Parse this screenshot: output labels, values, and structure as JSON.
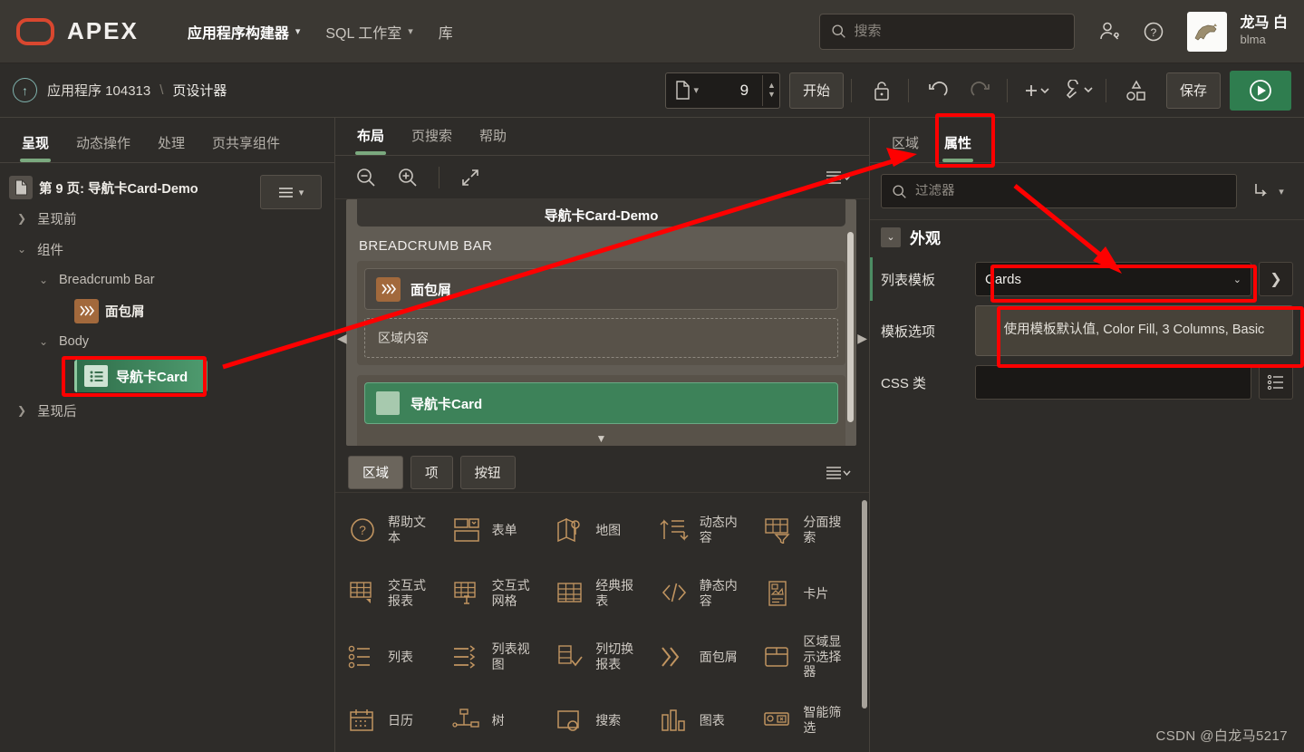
{
  "topnav": {
    "brand": "APEX",
    "items": [
      {
        "label": "应用程序构建器",
        "caret": true,
        "active": true
      },
      {
        "label": "SQL 工作室",
        "caret": true,
        "active": false
      },
      {
        "label": "库",
        "caret": false,
        "active": false
      }
    ],
    "search_placeholder": "搜索",
    "user_name": "龙马 白",
    "user_handle": "blma",
    "icons": [
      "user-settings-icon",
      "help-icon"
    ]
  },
  "toolbar": {
    "breadcrumb": {
      "app": "应用程序 104313",
      "sep": "\\",
      "current": "页设计器"
    },
    "page_number": "9",
    "start_label": "开始",
    "save_label": "保存",
    "icons": [
      "lock-icon",
      "undo-icon",
      "redo-icon",
      "add-icon",
      "utilities-icon",
      "shapes-icon",
      "run-icon"
    ]
  },
  "left_panel": {
    "tabs": [
      {
        "label": "呈现",
        "active": true
      },
      {
        "label": "动态操作",
        "active": false
      },
      {
        "label": "处理",
        "active": false
      },
      {
        "label": "页共享组件",
        "active": false
      }
    ],
    "tree": [
      {
        "label": "第 9 页: 导航卡Card-Demo",
        "type": "page",
        "indent": 0,
        "twisty": "",
        "bold": true
      },
      {
        "label": "呈现前",
        "type": "folder",
        "indent": 1,
        "twisty": "collapsed"
      },
      {
        "label": "组件",
        "type": "folder",
        "indent": 1,
        "twisty": "expanded"
      },
      {
        "label": "Breadcrumb Bar",
        "type": "folder",
        "indent": 2,
        "twisty": "expanded"
      },
      {
        "label": "面包屑",
        "type": "breadcrumb",
        "indent": 3,
        "twisty": ""
      },
      {
        "label": "Body",
        "type": "folder",
        "indent": 2,
        "twisty": "expanded"
      },
      {
        "label": "导航卡Card",
        "type": "list-selected",
        "indent": 3,
        "twisty": ""
      },
      {
        "label": "呈现后",
        "type": "folder",
        "indent": 1,
        "twisty": "collapsed"
      }
    ]
  },
  "center_panel": {
    "tabs": [
      {
        "label": "布局",
        "active": true
      },
      {
        "label": "页搜索",
        "active": false
      },
      {
        "label": "帮助",
        "active": false
      }
    ],
    "layout_toolbar_icons": [
      "zoom-out-icon",
      "zoom-in-icon",
      "expand-icon",
      "menu-icon"
    ],
    "preview": {
      "page_title": "导航卡Card-Demo",
      "section_title": "BREADCRUMB BAR",
      "breadcrumb_region": "面包屑",
      "region_content_placeholder": "区域内容",
      "card_region": "导航卡Card"
    },
    "gallery": {
      "tabs": [
        {
          "label": "区域",
          "active": true
        },
        {
          "label": "项",
          "active": false
        },
        {
          "label": "按钮",
          "active": false
        }
      ],
      "items": [
        {
          "label": "帮助文本",
          "icon": "help-text-icon"
        },
        {
          "label": "表单",
          "icon": "form-icon"
        },
        {
          "label": "地图",
          "icon": "map-icon"
        },
        {
          "label": "动态内容",
          "icon": "dynamic-content-icon"
        },
        {
          "label": "分面搜索",
          "icon": "faceted-search-icon"
        },
        {
          "label": "交互式报表",
          "icon": "interactive-report-icon"
        },
        {
          "label": "交互式网格",
          "icon": "interactive-grid-icon"
        },
        {
          "label": "经典报表",
          "icon": "classic-report-icon"
        },
        {
          "label": "静态内容",
          "icon": "static-content-icon"
        },
        {
          "label": "卡片",
          "icon": "cards-icon"
        },
        {
          "label": "列表",
          "icon": "list-icon"
        },
        {
          "label": "列表视图",
          "icon": "list-view-icon"
        },
        {
          "label": "列切换报表",
          "icon": "column-toggle-report-icon"
        },
        {
          "label": "面包屑",
          "icon": "breadcrumb-icon"
        },
        {
          "label": "区域显示选择器",
          "icon": "region-display-selector-icon"
        },
        {
          "label": "日历",
          "icon": "calendar-icon"
        },
        {
          "label": "树",
          "icon": "tree-icon"
        },
        {
          "label": "搜索",
          "icon": "search-region-icon"
        },
        {
          "label": "图表",
          "icon": "chart-icon"
        },
        {
          "label": "智能筛选",
          "icon": "smart-filter-icon"
        }
      ]
    }
  },
  "right_panel": {
    "tabs": [
      {
        "label": "区域",
        "active": false
      },
      {
        "label": "属性",
        "active": true
      }
    ],
    "filter_placeholder": "过滤器",
    "section_appearance": "外观",
    "properties": [
      {
        "label": "列表模板",
        "value": "Cards",
        "type": "select",
        "highlighted": true
      },
      {
        "label": "模板选项",
        "value": "使用模板默认值, Color Fill, 3 Columns, Basic",
        "type": "multiline",
        "highlighted": true
      },
      {
        "label": "CSS 类",
        "value": "",
        "type": "text",
        "highlighted": false
      }
    ]
  },
  "watermark": "CSDN @白龙马5217",
  "colors": {
    "accent_green": "#3d8259",
    "annotation_red": "#fe0000",
    "brand_red": "#d9472f",
    "panel_bg": "#2e2c29",
    "header_bg": "#3b3833"
  }
}
